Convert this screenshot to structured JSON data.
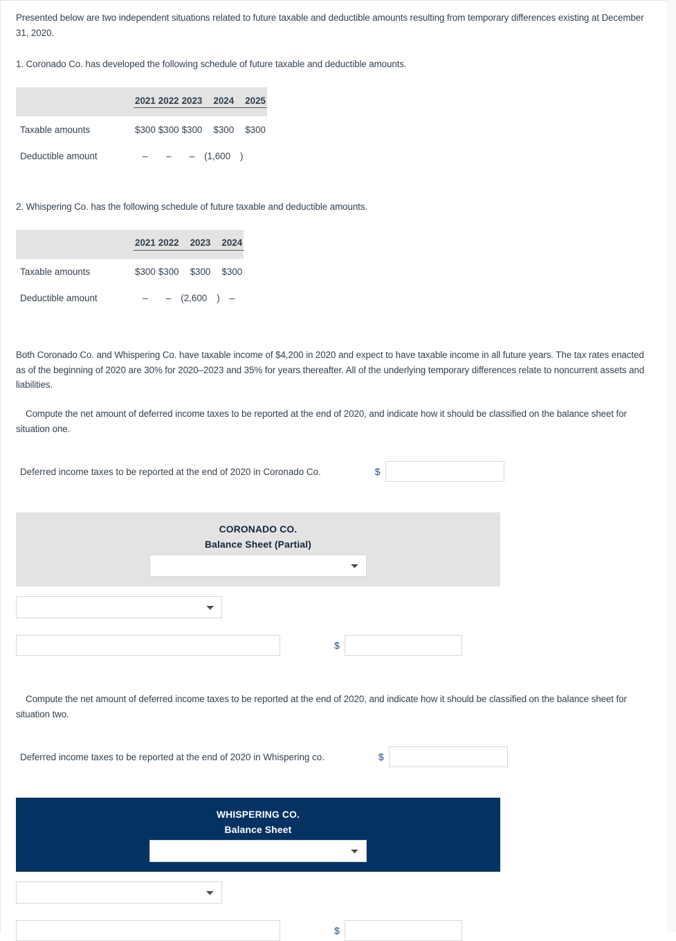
{
  "intro": {
    "paragraph": "Presented below are two independent situations related to future taxable and deductible amounts resulting from temporary differences existing at December 31, 2020."
  },
  "situation_one": {
    "heading": "1. Coronado Co. has developed the following schedule of future taxable and deductible amounts.",
    "table": {
      "corner_label": "",
      "columns": [
        "2021",
        "2022",
        "2023",
        "2024",
        "2025"
      ],
      "rows": [
        {
          "label": "Taxable amounts",
          "values": [
            "$300",
            "$300",
            "$300",
            "$300",
            "$300"
          ]
        },
        {
          "label": "Deductible amount",
          "values": [
            "–",
            "–",
            "–",
            "(1,600",
            " "
          ],
          "paren_close": ")"
        }
      ]
    }
  },
  "situation_two": {
    "heading": "2. Whispering Co. has the following schedule of future taxable and deductible amounts.",
    "table": {
      "columns": [
        "2021",
        "2022",
        "2023",
        "2024"
      ],
      "rows": [
        {
          "label": "Taxable amounts",
          "values": [
            "$300",
            "$300",
            "$300",
            "$300"
          ]
        },
        {
          "label": "Deductible amount",
          "values": [
            "–",
            "–",
            "(2,600",
            "–"
          ],
          "paren_close": ")"
        }
      ]
    }
  },
  "background": {
    "paragraph": "Both Coronado Co. and Whispering Co. have taxable income of $4,200 in 2020 and expect to have taxable income in all future years. The tax rates enacted as of the beginning of 2020 are 30% for 2020–2023 and 35% for years thereafter. All of the underlying temporary differences relate to noncurrent assets and liabilities."
  },
  "requirement_one": {
    "instruction": "Compute the net amount of deferred income taxes to be reported at the end of 2020, and indicate how it should be classified on the balance sheet for situation one.",
    "entry_label": "Deferred income taxes to be reported at the end of 2020 in Coronado Co.",
    "currency_symbol": "$",
    "entry_value": "",
    "entry_placeholder": ""
  },
  "coronado_balance_sheet": {
    "company_name": "CORONADO CO.",
    "statement_title": "Balance Sheet (Partial)",
    "panel_color": "#e3e3e3",
    "title_select": {
      "value": "",
      "options": []
    },
    "section_select": {
      "value": "",
      "options": []
    },
    "line_item": {
      "value": "",
      "placeholder": ""
    },
    "currency_symbol": "$",
    "amount": {
      "value": "",
      "placeholder": ""
    }
  },
  "requirement_two": {
    "instruction": "Compute the net amount of deferred income taxes to be reported at the end of 2020, and indicate how it should be classified on the balance sheet for situation two.",
    "entry_label": "Deferred income taxes to be reported at the end of 2020 in Whispering co.",
    "currency_symbol": "$",
    "entry_value": "",
    "entry_placeholder": ""
  },
  "whispering_balance_sheet": {
    "company_name": "WHISPERING CO.",
    "statement_title": "Balance Sheet",
    "panel_color": "#043363",
    "title_select": {
      "value": "",
      "options": []
    },
    "section_select": {
      "value": "",
      "options": []
    },
    "line_item": {
      "value": "",
      "placeholder": ""
    },
    "currency_symbol": "$",
    "amount": {
      "value": "",
      "placeholder": ""
    }
  }
}
